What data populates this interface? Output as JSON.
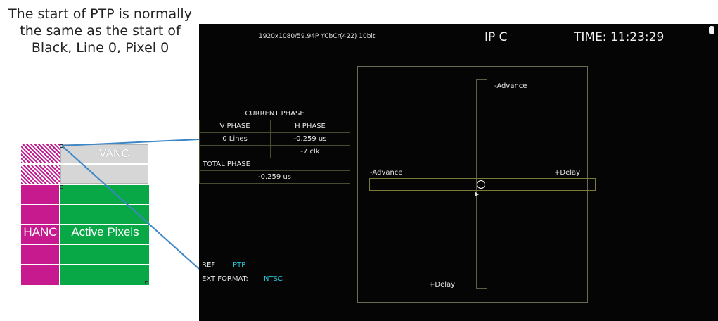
{
  "caption": {
    "lines": [
      "The start of PTP is normally",
      "the same as the start of",
      "Black, Line 0, Pixel 0"
    ]
  },
  "frame_diagram": {
    "vanc_label": "VANC",
    "hanc_label": "HANC",
    "active_label": "Active Pixels"
  },
  "monitor": {
    "format": "1920x1080/59.94P YCbCr(422) 10bit",
    "input": "IP C",
    "time": "TIME: 11:23:29",
    "phase_table": {
      "title": "CURRENT PHASE",
      "v_phase_header": "V PHASE",
      "h_phase_header": "H PHASE",
      "v_phase_value": "0 Lines",
      "h_phase_us": "-0.259 us",
      "h_phase_clk": "-7 clk",
      "total_header": "TOTAL PHASE",
      "total_value": "-0.259 us"
    },
    "crosshair": {
      "top_label": "-Advance",
      "left_label": "-Advance",
      "right_label": "+Delay",
      "bottom_label": "+Delay"
    },
    "ref_label": "REF",
    "ref_value": "PTP",
    "ext_format_label": "EXT FORMAT:",
    "ext_format_value": "NTSC"
  },
  "colors": {
    "hanc_magenta": "#c71a8e",
    "active_green": "#07a845",
    "vanc_gray": "#d6d6d6",
    "connector_blue": "#3d86c6",
    "screen_bg": "#050505",
    "accent_cyan": "#26c6d6"
  }
}
